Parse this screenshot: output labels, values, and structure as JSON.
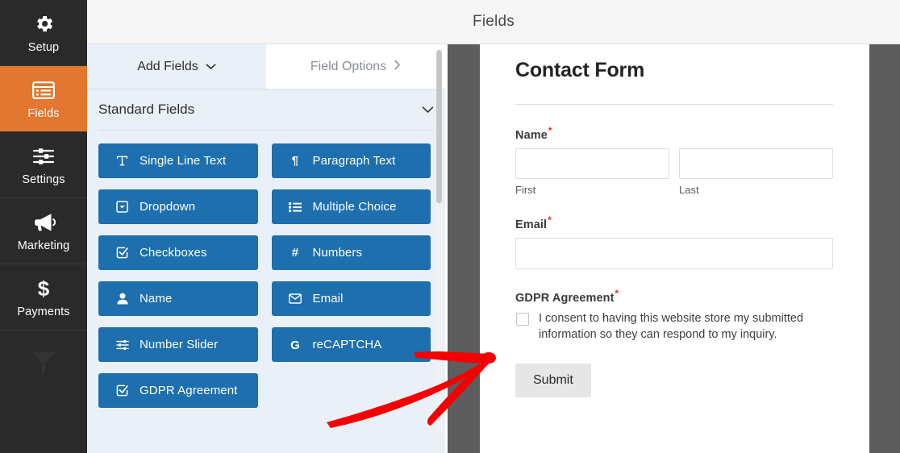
{
  "header": {
    "title": "Fields"
  },
  "sidebar": {
    "items": [
      {
        "label": "Setup",
        "icon": "gear-icon",
        "active": false
      },
      {
        "label": "Fields",
        "icon": "list-icon",
        "active": true
      },
      {
        "label": "Settings",
        "icon": "sliders-icon",
        "active": false
      },
      {
        "label": "Marketing",
        "icon": "megaphone-icon",
        "active": false
      },
      {
        "label": "Payments",
        "icon": "dollar-icon",
        "active": false
      }
    ],
    "active_color": "#e27730",
    "background_color": "#2a2a2a"
  },
  "panel": {
    "tabs": [
      {
        "label": "Add Fields",
        "icon": "chevron-down-icon",
        "active": true
      },
      {
        "label": "Field Options",
        "icon": "chevron-right-icon",
        "active": false
      }
    ],
    "section": {
      "title": "Standard Fields",
      "collapse_icon": "chevron-down-icon"
    },
    "field_buttons": [
      {
        "label": "Single Line Text",
        "icon": "text-cursor-icon"
      },
      {
        "label": "Paragraph Text",
        "icon": "pilcrow-icon"
      },
      {
        "label": "Dropdown",
        "icon": "dropdown-icon"
      },
      {
        "label": "Multiple Choice",
        "icon": "list-ul-icon"
      },
      {
        "label": "Checkboxes",
        "icon": "checkbox-checked-icon"
      },
      {
        "label": "Numbers",
        "icon": "hash-icon"
      },
      {
        "label": "Name",
        "icon": "user-icon"
      },
      {
        "label": "Email",
        "icon": "envelope-icon"
      },
      {
        "label": "Number Slider",
        "icon": "slider-icon"
      },
      {
        "label": "reCAPTCHA",
        "icon": "google-g-icon"
      },
      {
        "label": "GDPR Agreement",
        "icon": "checkbox-checked-icon"
      }
    ],
    "button_color": "#1d6fae",
    "background_color": "#e9f0f8"
  },
  "preview": {
    "form_title": "Contact Form",
    "required_marker": "*",
    "fields": [
      {
        "label": "Name",
        "required": true,
        "type": "name",
        "subfields": [
          {
            "sublabel": "First",
            "value": ""
          },
          {
            "sublabel": "Last",
            "value": ""
          }
        ]
      },
      {
        "label": "Email",
        "required": true,
        "type": "email",
        "value": ""
      },
      {
        "label": "GDPR Agreement",
        "required": true,
        "type": "gdpr-checkbox",
        "checked": false,
        "consent_text": "I consent to having this website store my submitted information so they can respond to my inquiry."
      }
    ],
    "submit_label": "Submit"
  },
  "annotation": {
    "type": "arrow",
    "color": "#f50000",
    "points_to": "gdpr-consent-checkbox"
  }
}
